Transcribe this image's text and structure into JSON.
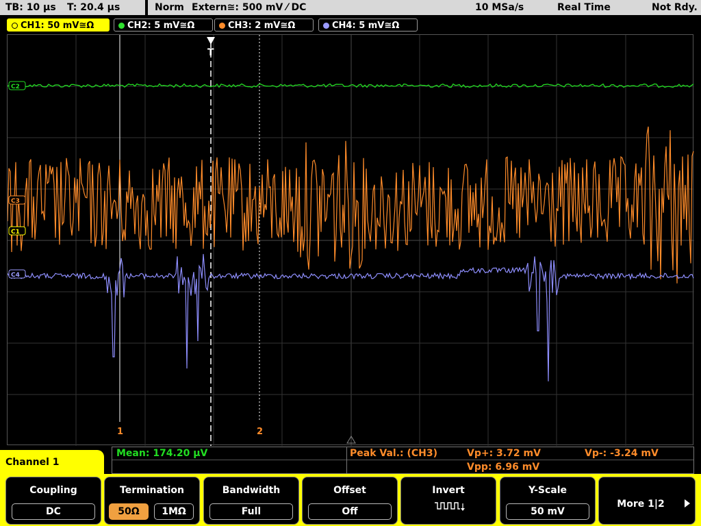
{
  "topbar": {
    "timebase": "TB: 10 µs",
    "trigger_time": "T: 20.4 µs",
    "mode": "Norm",
    "trigger_source": "Extern≅: 500 mV ⁄ DC",
    "sample_rate": "10 MSa/s",
    "acq_mode": "Real Time",
    "status": "Not Rdy."
  },
  "channels": [
    {
      "label": "CH1: 50 mV≅Ω",
      "color": "#ffff00"
    },
    {
      "label": "CH2: 5 mV≅Ω",
      "color": "#2ee02e"
    },
    {
      "label": "CH3: 2 mV≅Ω",
      "color": "#ff8c2a"
    },
    {
      "label": "CH4: 5 mV≅Ω",
      "color": "#9b9bff"
    }
  ],
  "markers": {
    "trigger": "T",
    "cursor1": "1",
    "cursor2": "2",
    "ch1": "C1",
    "ch2": "C2",
    "ch3": "C3",
    "ch4": "C4"
  },
  "measurements": {
    "mean": "Mean: 174.20 µV",
    "peak_label": "Peak Val.:  (CH3)",
    "vp_plus": "Vp+: 3.72 mV",
    "vp_minus": "Vp-: -3.24 mV",
    "vpp": "Vpp: 6.96 mV"
  },
  "menu": {
    "channel_label": "Channel 1",
    "coupling": {
      "title": "Coupling",
      "value": "DC"
    },
    "termination": {
      "title": "Termination",
      "opt1": "50Ω",
      "opt2": "1MΩ",
      "selected": "50Ω"
    },
    "bandwidth": {
      "title": "Bandwidth",
      "value": "Full"
    },
    "offset": {
      "title": "Offset",
      "value": "Off"
    },
    "invert": {
      "title": "Invert"
    },
    "yscale": {
      "title": "Y-Scale",
      "value": "50 mV"
    },
    "more": {
      "label": "More 1|2"
    }
  }
}
